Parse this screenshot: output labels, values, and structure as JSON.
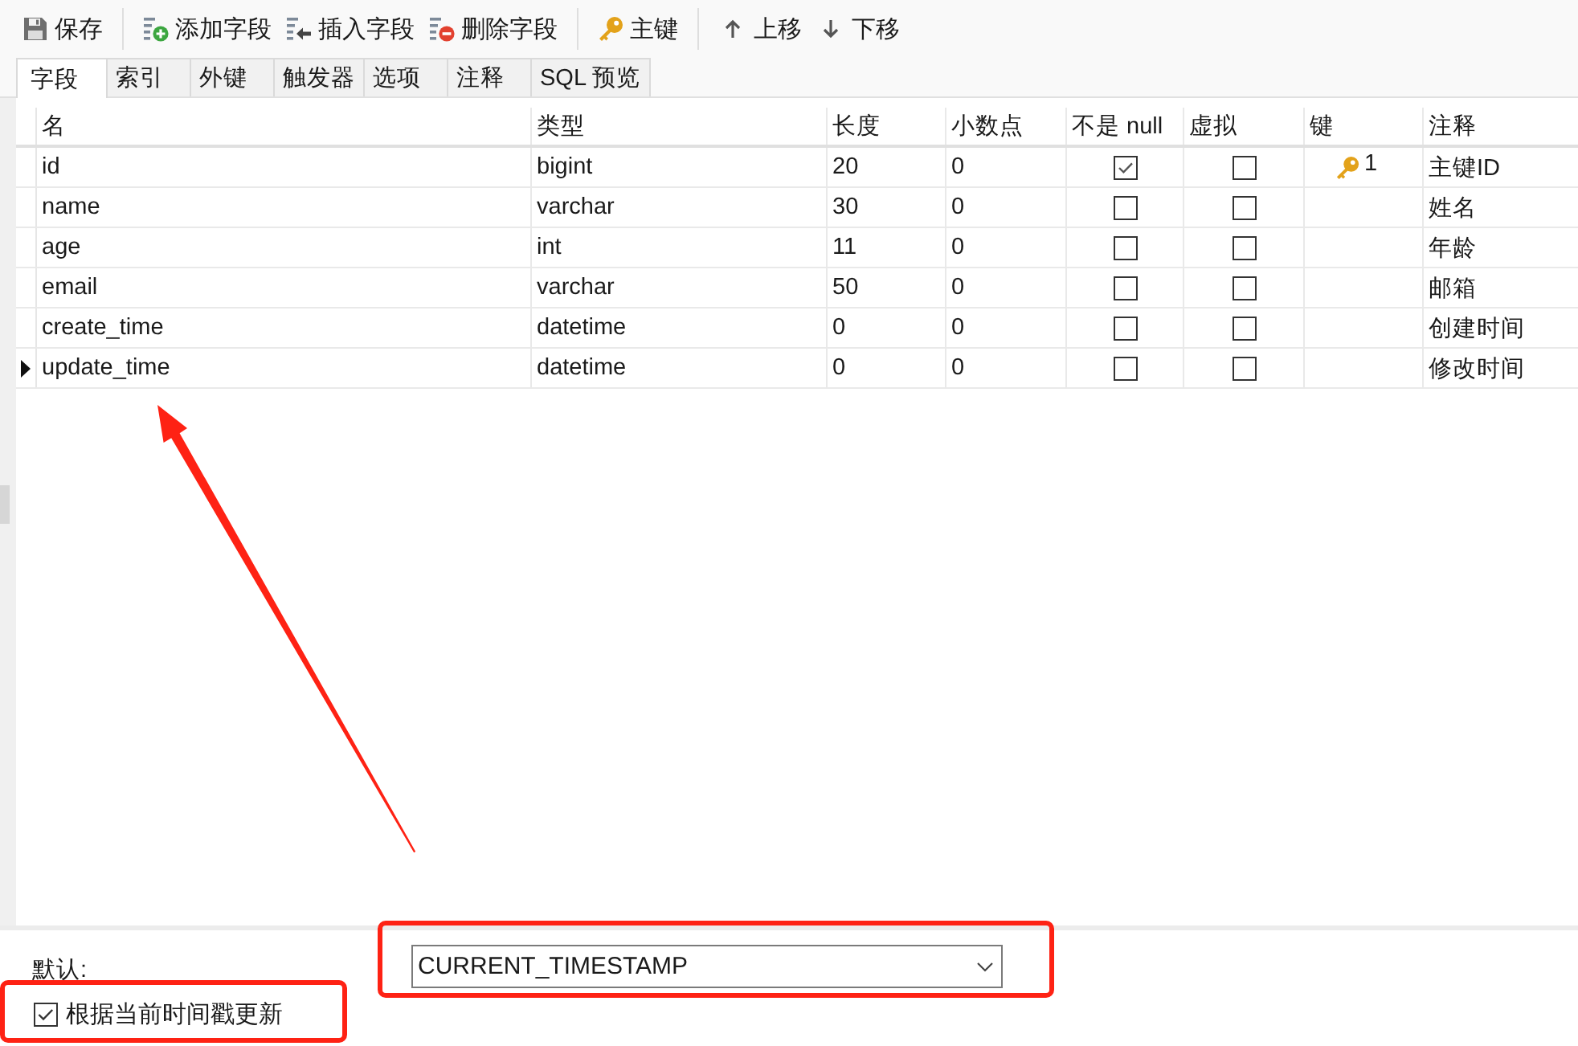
{
  "toolbar": {
    "groups": [
      [
        {
          "kind": "save",
          "label": "保存"
        }
      ],
      [
        {
          "kind": "add_field",
          "label": "添加字段"
        },
        {
          "kind": "insert_field",
          "label": "插入字段"
        },
        {
          "kind": "delete_field",
          "label": "删除字段"
        }
      ],
      [
        {
          "kind": "primary_key",
          "label": "主键"
        }
      ],
      [
        {
          "kind": "move_up",
          "label": "上移"
        },
        {
          "kind": "move_down",
          "label": "下移"
        }
      ]
    ]
  },
  "tabs": [
    {
      "label": "字段",
      "selected": true
    },
    {
      "label": "索引",
      "selected": false
    },
    {
      "label": "外键",
      "selected": false
    },
    {
      "label": "触发器",
      "selected": false
    },
    {
      "label": "选项",
      "selected": false
    },
    {
      "label": "注释",
      "selected": false
    },
    {
      "label": "SQL 预览",
      "selected": false
    }
  ],
  "columns": [
    "名",
    "类型",
    "长度",
    "小数点",
    "不是 null",
    "虚拟",
    "键",
    "注释"
  ],
  "rows": [
    {
      "name": "id",
      "type": "bigint",
      "length": "20",
      "decimals": "0",
      "not_null": true,
      "virtual": false,
      "key": "1",
      "comment": "主键ID",
      "current": false
    },
    {
      "name": "name",
      "type": "varchar",
      "length": "30",
      "decimals": "0",
      "not_null": false,
      "virtual": false,
      "comment": "姓名",
      "current": false
    },
    {
      "name": "age",
      "type": "int",
      "length": "11",
      "decimals": "0",
      "not_null": false,
      "virtual": false,
      "comment": "年龄",
      "current": false
    },
    {
      "name": "email",
      "type": "varchar",
      "length": "50",
      "decimals": "0",
      "not_null": false,
      "virtual": false,
      "comment": "邮箱",
      "current": false
    },
    {
      "name": "create_time",
      "type": "datetime",
      "length": "0",
      "decimals": "0",
      "not_null": false,
      "virtual": false,
      "comment": "创建时间",
      "current": false
    },
    {
      "name": "update_time",
      "type": "datetime",
      "length": "0",
      "decimals": "0",
      "not_null": false,
      "virtual": false,
      "comment": "修改时间",
      "current": true
    }
  ],
  "default_field": {
    "label": "默认:",
    "value": "CURRENT_TIMESTAMP"
  },
  "on_update": {
    "label": "根据当前时间戳更新",
    "checked": true
  }
}
